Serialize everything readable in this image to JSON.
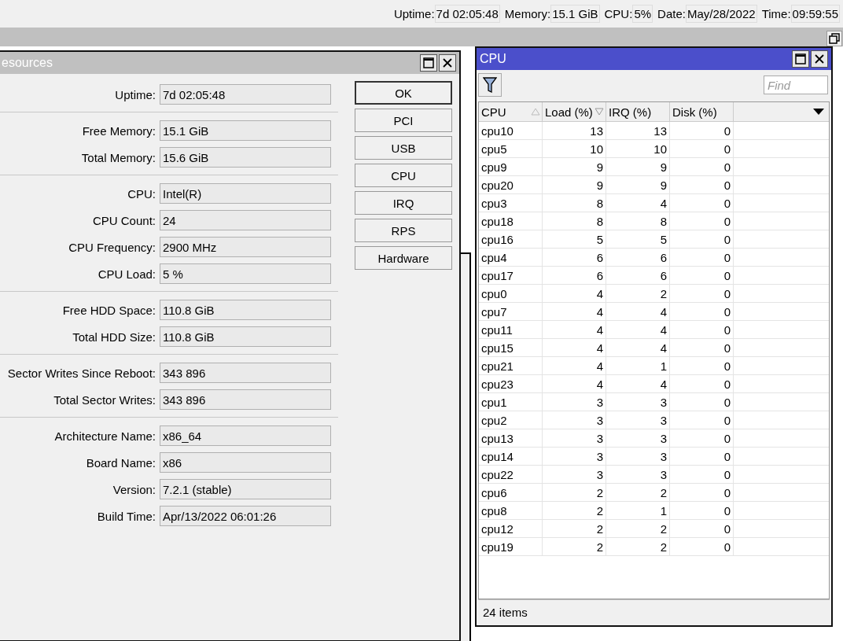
{
  "status_bar": [
    {
      "label": "Uptime:",
      "value": "7d 02:05:48"
    },
    {
      "label": "Memory:",
      "value": "15.1 GiB"
    },
    {
      "label": "CPU:",
      "value": "5%"
    },
    {
      "label": "Date:",
      "value": "May/28/2022"
    },
    {
      "label": "Time:",
      "value": "09:59:55"
    }
  ],
  "resources_window": {
    "title": "esources",
    "groups": [
      [
        {
          "label": "Uptime:",
          "value": "7d 02:05:48"
        }
      ],
      [
        {
          "label": "Free Memory:",
          "value": "15.1 GiB"
        },
        {
          "label": "Total Memory:",
          "value": "15.6 GiB"
        }
      ],
      [
        {
          "label": "CPU:",
          "value": "Intel(R)"
        },
        {
          "label": "CPU Count:",
          "value": "24"
        },
        {
          "label": "CPU Frequency:",
          "value": "2900 MHz"
        },
        {
          "label": "CPU Load:",
          "value": "5 %"
        }
      ],
      [
        {
          "label": "Free HDD Space:",
          "value": "110.8 GiB"
        },
        {
          "label": "Total HDD Size:",
          "value": "110.8 GiB"
        }
      ],
      [
        {
          "label": "Sector Writes Since Reboot:",
          "value": "343 896"
        },
        {
          "label": "Total Sector Writes:",
          "value": "343 896"
        }
      ],
      [
        {
          "label": "Architecture Name:",
          "value": "x86_64"
        },
        {
          "label": "Board Name:",
          "value": "x86"
        },
        {
          "label": "Version:",
          "value": "7.2.1 (stable)"
        },
        {
          "label": "Build Time:",
          "value": "Apr/13/2022 06:01:26"
        }
      ]
    ],
    "buttons": [
      {
        "label": "OK",
        "default": true
      },
      {
        "label": "PCI",
        "default": false
      },
      {
        "label": "USB",
        "default": false
      },
      {
        "label": "CPU",
        "default": false
      },
      {
        "label": "IRQ",
        "default": false
      },
      {
        "label": "RPS",
        "default": false
      },
      {
        "label": "Hardware",
        "default": false
      }
    ]
  },
  "cpu_window": {
    "title": "CPU",
    "find": {
      "placeholder": "Find"
    },
    "table": {
      "columns": [
        {
          "label": "CPU",
          "ascending": true,
          "descending": false
        },
        {
          "label": "Load (%)",
          "ascending": false,
          "descending": true
        },
        {
          "label": "IRQ (%)",
          "ascending": false,
          "descending": false
        },
        {
          "label": "Disk (%)",
          "ascending": false,
          "descending": false
        }
      ],
      "rows": [
        [
          "cpu10",
          "13",
          "13",
          "0"
        ],
        [
          "cpu5",
          "10",
          "10",
          "0"
        ],
        [
          "cpu9",
          "9",
          "9",
          "0"
        ],
        [
          "cpu20",
          "9",
          "9",
          "0"
        ],
        [
          "cpu3",
          "8",
          "4",
          "0"
        ],
        [
          "cpu18",
          "8",
          "8",
          "0"
        ],
        [
          "cpu16",
          "5",
          "5",
          "0"
        ],
        [
          "cpu4",
          "6",
          "6",
          "0"
        ],
        [
          "cpu17",
          "6",
          "6",
          "0"
        ],
        [
          "cpu0",
          "4",
          "2",
          "0"
        ],
        [
          "cpu7",
          "4",
          "4",
          "0"
        ],
        [
          "cpu11",
          "4",
          "4",
          "0"
        ],
        [
          "cpu15",
          "4",
          "4",
          "0"
        ],
        [
          "cpu21",
          "4",
          "1",
          "0"
        ],
        [
          "cpu23",
          "4",
          "4",
          "0"
        ],
        [
          "cpu1",
          "3",
          "3",
          "0"
        ],
        [
          "cpu2",
          "3",
          "3",
          "0"
        ],
        [
          "cpu13",
          "3",
          "3",
          "0"
        ],
        [
          "cpu14",
          "3",
          "3",
          "0"
        ],
        [
          "cpu22",
          "3",
          "3",
          "0"
        ],
        [
          "cpu6",
          "2",
          "2",
          "0"
        ],
        [
          "cpu8",
          "2",
          "1",
          "0"
        ],
        [
          "cpu12",
          "2",
          "2",
          "0"
        ],
        [
          "cpu19",
          "2",
          "2",
          "0"
        ]
      ]
    },
    "footer": "24 items"
  }
}
